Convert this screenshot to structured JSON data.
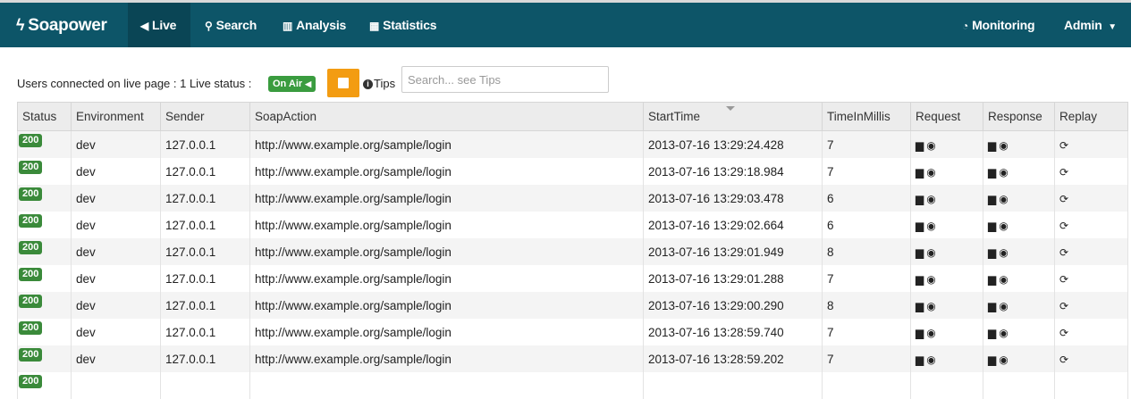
{
  "nav": {
    "brand": "Soapower",
    "left": [
      {
        "label": "Live",
        "icon": "bullhorn-icon",
        "glyph": "📢",
        "active": true
      },
      {
        "label": "Search",
        "icon": "search-icon",
        "glyph": "🔍"
      },
      {
        "label": "Analysis",
        "icon": "bar-chart-icon",
        "glyph": "📊"
      },
      {
        "label": "Statistics",
        "icon": "table-icon",
        "glyph": "▦"
      }
    ],
    "right": [
      {
        "label": "Monitoring",
        "icon": "dashboard-icon",
        "glyph": "⏲"
      },
      {
        "label": "Admin",
        "icon": "caret-down-icon",
        "glyph": "▾"
      }
    ]
  },
  "toolbar": {
    "users_text": "Users connected on live page : 1 Live status :",
    "on_air_label": "On Air",
    "tips_label": "Tips",
    "search_placeholder": "Search... see Tips"
  },
  "table": {
    "headers": [
      "Status",
      "Environment",
      "Sender",
      "SoapAction",
      "StartTime",
      "TimeInMillis",
      "Request",
      "Response",
      "Replay"
    ],
    "sorted_column": "StartTime",
    "rows": [
      {
        "status": "200",
        "environment": "dev",
        "sender": "127.0.0.1",
        "soap_action": "http://www.example.org/sample/login",
        "start_time": "2013-07-16 13:29:24.428",
        "time_in_millis": "7"
      },
      {
        "status": "200",
        "environment": "dev",
        "sender": "127.0.0.1",
        "soap_action": "http://www.example.org/sample/login",
        "start_time": "2013-07-16 13:29:18.984",
        "time_in_millis": "7"
      },
      {
        "status": "200",
        "environment": "dev",
        "sender": "127.0.0.1",
        "soap_action": "http://www.example.org/sample/login",
        "start_time": "2013-07-16 13:29:03.478",
        "time_in_millis": "6"
      },
      {
        "status": "200",
        "environment": "dev",
        "sender": "127.0.0.1",
        "soap_action": "http://www.example.org/sample/login",
        "start_time": "2013-07-16 13:29:02.664",
        "time_in_millis": "6"
      },
      {
        "status": "200",
        "environment": "dev",
        "sender": "127.0.0.1",
        "soap_action": "http://www.example.org/sample/login",
        "start_time": "2013-07-16 13:29:01.949",
        "time_in_millis": "8"
      },
      {
        "status": "200",
        "environment": "dev",
        "sender": "127.0.0.1",
        "soap_action": "http://www.example.org/sample/login",
        "start_time": "2013-07-16 13:29:01.288",
        "time_in_millis": "7"
      },
      {
        "status": "200",
        "environment": "dev",
        "sender": "127.0.0.1",
        "soap_action": "http://www.example.org/sample/login",
        "start_time": "2013-07-16 13:29:00.290",
        "time_in_millis": "8"
      },
      {
        "status": "200",
        "environment": "dev",
        "sender": "127.0.0.1",
        "soap_action": "http://www.example.org/sample/login",
        "start_time": "2013-07-16 13:28:59.740",
        "time_in_millis": "7"
      },
      {
        "status": "200",
        "environment": "dev",
        "sender": "127.0.0.1",
        "soap_action": "http://www.example.org/sample/login",
        "start_time": "2013-07-16 13:28:59.202",
        "time_in_millis": "7"
      },
      {
        "status": "200",
        "environment": "",
        "sender": "",
        "soap_action": "",
        "start_time": "",
        "time_in_millis": ""
      }
    ],
    "row_icons": {
      "file": "📄",
      "eye": "👁",
      "replay": "⟳"
    }
  },
  "colors": {
    "navbar": "#0d5568",
    "on_air": "#3a9c3f",
    "stop_button": "#f39c12",
    "badge": "#3a8a3a"
  }
}
